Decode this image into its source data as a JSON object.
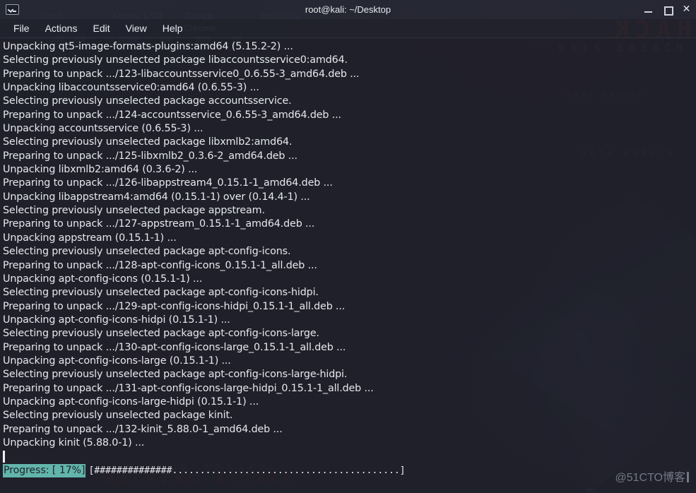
{
  "window": {
    "title": "root@kali: ~/Desktop",
    "icon": "terminal-icon",
    "controls": {
      "minimize": "_",
      "maximize": "□",
      "close": "✕"
    }
  },
  "menubar": {
    "items": [
      {
        "label": "File"
      },
      {
        "label": "Actions"
      },
      {
        "label": "Edit"
      },
      {
        "label": "View"
      },
      {
        "label": "Help"
      }
    ]
  },
  "desktop": {
    "icons": [
      {
        "label": "Trash"
      },
      {
        "label": "Firefox ESR"
      },
      {
        "label": "Google Chrome"
      },
      {
        "label": "intell idea"
      }
    ],
    "wallpaper_text": {
      "hack_mirrored": "HACK",
      "breach_1": "DATA BREACH",
      "breach_2": "DATA BREACH",
      "breach_3": "DATA BREACH",
      "breach_4": "DATA BREACH",
      "breach_5": "DATA BREACH",
      "bottom_1": "HACKING ATTACK",
      "bottom_2": "HACKING ATTACK"
    }
  },
  "terminal": {
    "lines": [
      "Unpacking qt5-image-formats-plugins:amd64 (5.15.2-2) ...",
      "Selecting previously unselected package libaccountsservice0:amd64.",
      "Preparing to unpack .../123-libaccountsservice0_0.6.55-3_amd64.deb ...",
      "Unpacking libaccountsservice0:amd64 (0.6.55-3) ...",
      "Selecting previously unselected package accountsservice.",
      "Preparing to unpack .../124-accountsservice_0.6.55-3_amd64.deb ...",
      "Unpacking accountsservice (0.6.55-3) ...",
      "Selecting previously unselected package libxmlb2:amd64.",
      "Preparing to unpack .../125-libxmlb2_0.3.6-2_amd64.deb ...",
      "Unpacking libxmlb2:amd64 (0.3.6-2) ...",
      "Preparing to unpack .../126-libappstream4_0.15.1-1_amd64.deb ...",
      "Unpacking libappstream4:amd64 (0.15.1-1) over (0.14.4-1) ...",
      "Selecting previously unselected package appstream.",
      "Preparing to unpack .../127-appstream_0.15.1-1_amd64.deb ...",
      "Unpacking appstream (0.15.1-1) ...",
      "Selecting previously unselected package apt-config-icons.",
      "Preparing to unpack .../128-apt-config-icons_0.15.1-1_all.deb ...",
      "Unpacking apt-config-icons (0.15.1-1) ...",
      "Selecting previously unselected package apt-config-icons-hidpi.",
      "Preparing to unpack .../129-apt-config-icons-hidpi_0.15.1-1_all.deb ...",
      "Unpacking apt-config-icons-hidpi (0.15.1-1) ...",
      "Selecting previously unselected package apt-config-icons-large.",
      "Preparing to unpack .../130-apt-config-icons-large_0.15.1-1_all.deb ...",
      "Unpacking apt-config-icons-large (0.15.1-1) ...",
      "Selecting previously unselected package apt-config-icons-large-hidpi.",
      "Preparing to unpack .../131-apt-config-icons-large-hidpi_0.15.1-1_all.deb ...",
      "Unpacking apt-config-icons-large-hidpi (0.15.1-1) ...",
      "Selecting previously unselected package kinit.",
      "Preparing to unpack .../132-kinit_5.88.0-1_amd64.deb ...",
      "Unpacking kinit (5.88.0-1) ..."
    ],
    "progress": {
      "label": "Progress: [ 17%]",
      "percent": 17,
      "bar": "[##############.........................................]",
      "label_background": "#62b5ab",
      "label_foreground": "#1e2029"
    },
    "cursor_visible": true,
    "background": "#1f212b",
    "foreground": "#e6e8ee"
  },
  "watermark": {
    "text": "@51CTO博客"
  }
}
